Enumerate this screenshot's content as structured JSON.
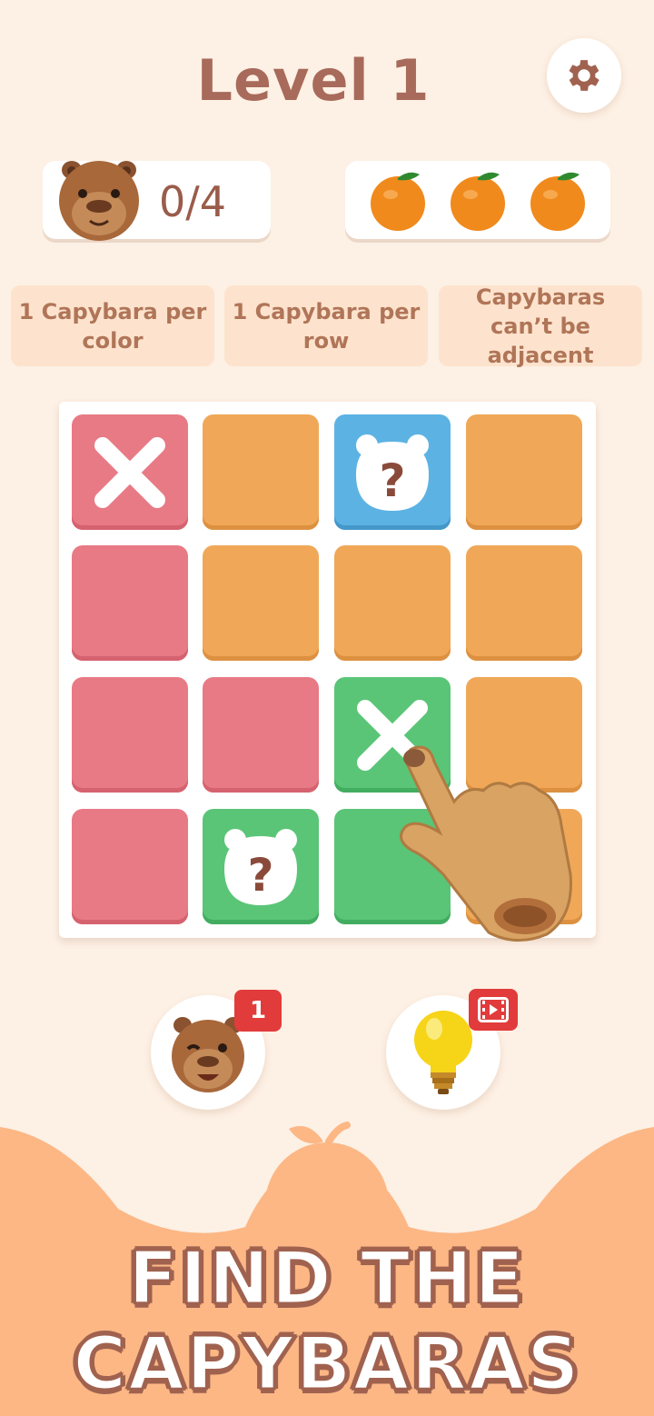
{
  "header": {
    "title": "Level 1",
    "settings_icon": "gear-icon"
  },
  "progress": {
    "found": "0/4",
    "capybara_icon": "capybara-icon"
  },
  "lives": {
    "count": 3,
    "icon": "orange-icon"
  },
  "rules": [
    {
      "text": "1 Capybara per color"
    },
    {
      "text": "1 Capybara per row"
    },
    {
      "text": "Capybaras can’t be adjacent"
    }
  ],
  "board": {
    "size": 4,
    "cells": [
      [
        "pink-x",
        "orange",
        "blue-hint",
        "orange"
      ],
      [
        "pink",
        "orange",
        "orange",
        "orange"
      ],
      [
        "pink",
        "pink",
        "green-x",
        "orange"
      ],
      [
        "pink",
        "green-hint",
        "green",
        "orange"
      ]
    ],
    "hint_symbol": "?"
  },
  "tools": {
    "capybara_booster": {
      "badge": "1",
      "icon": "winking-capybara-icon"
    },
    "hint_booster": {
      "badge_icon": "video-ad-icon",
      "icon": "lightbulb-icon"
    }
  },
  "banner": {
    "line1": "FIND THE",
    "line2": "CAPYBARAS"
  },
  "colors": {
    "background": "#fdf0e4",
    "pink": "#e87a85",
    "orange": "#f0a858",
    "blue": "#5cb3e3",
    "green": "#5ac577",
    "text_brown": "#a86a5a",
    "bottom_orange": "#fcb785"
  }
}
